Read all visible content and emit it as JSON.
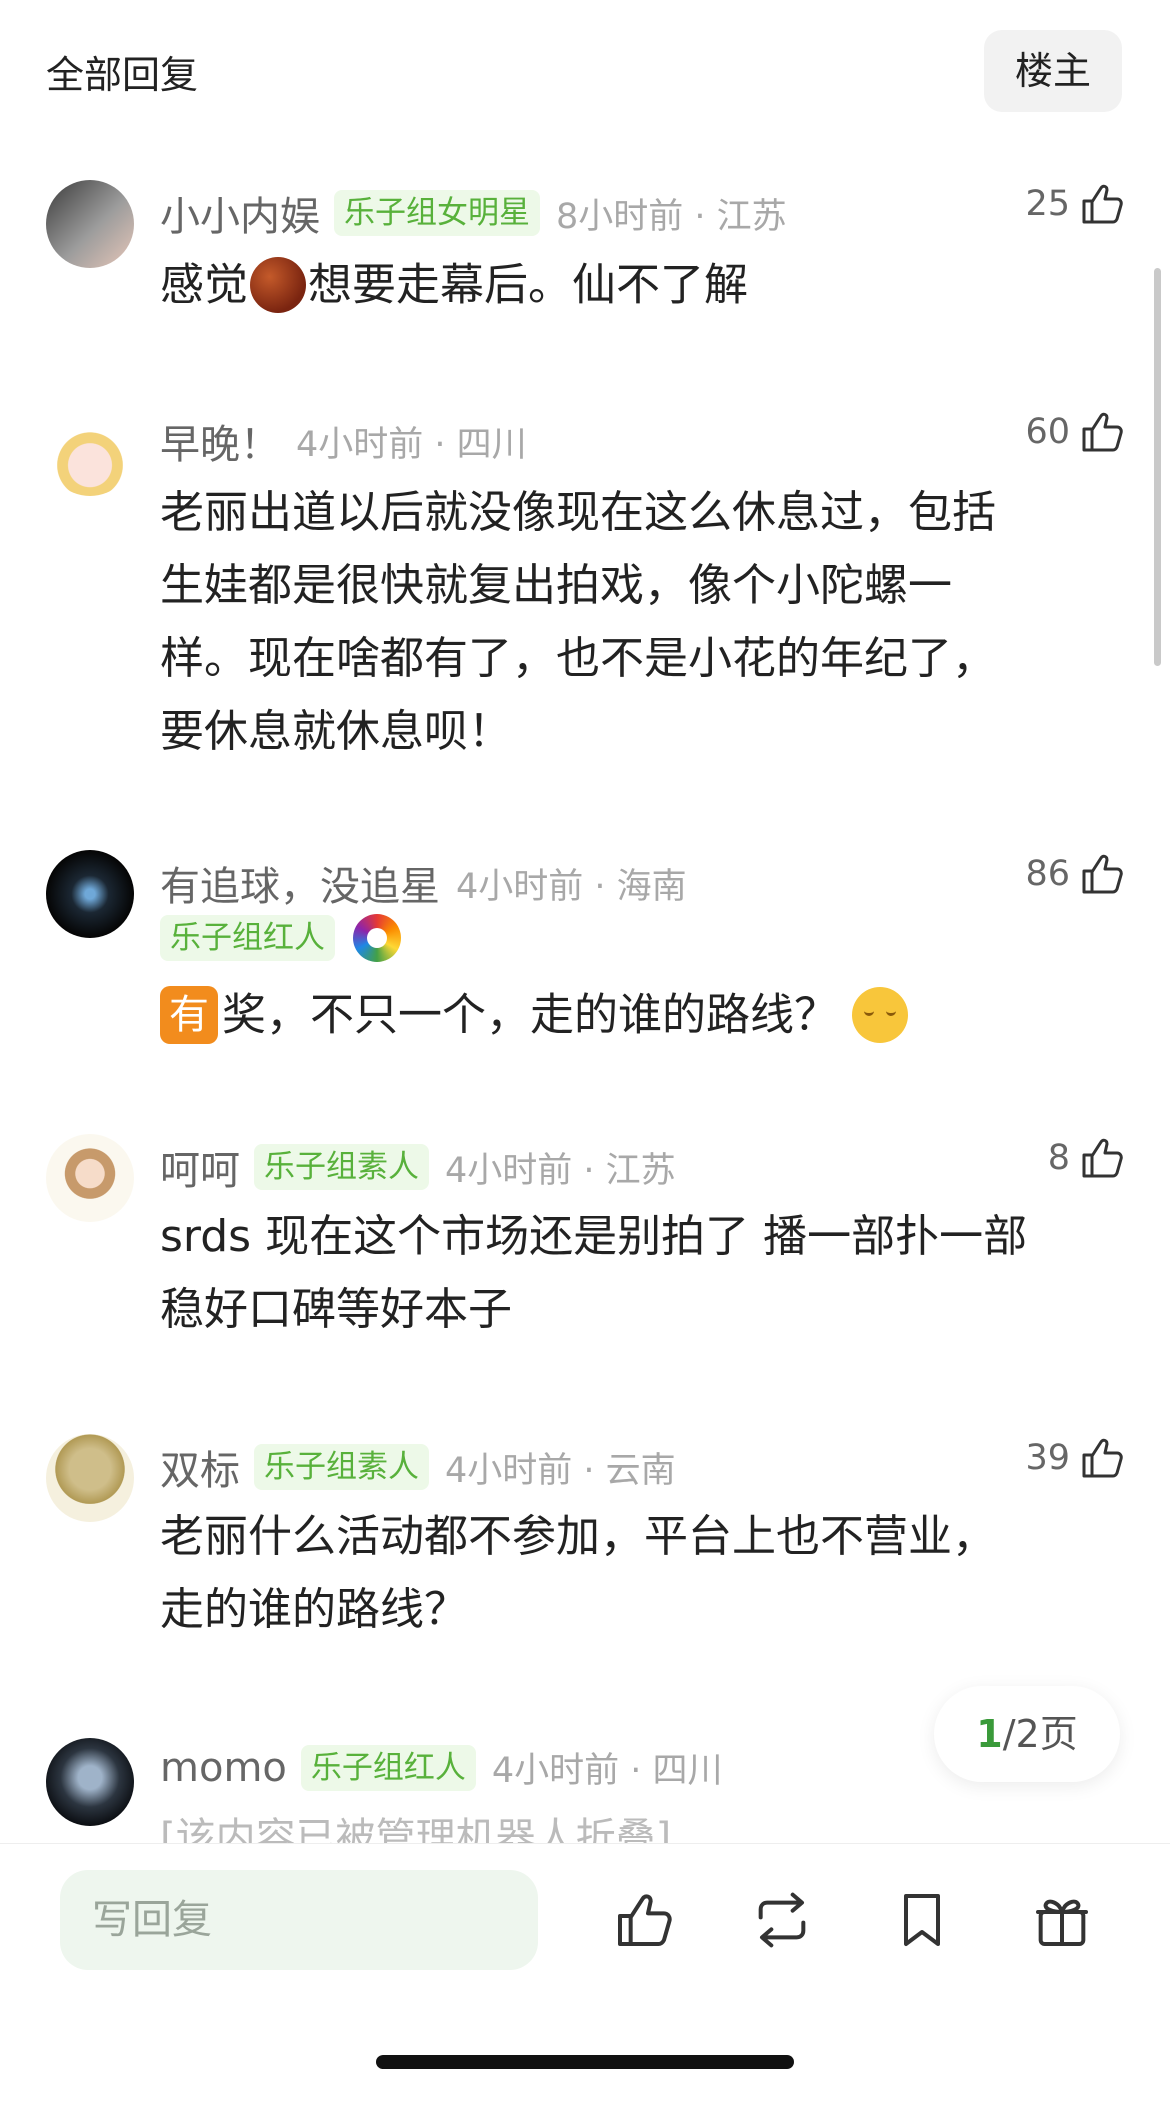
{
  "header": {
    "title": "全部回复",
    "op_button": "楼主"
  },
  "comments": [
    {
      "username": "小小内娱",
      "badge": "乐子组女明星",
      "time": "8小时前 · 江苏",
      "likes": "25",
      "text_a": "感觉",
      "text_b": "想要走幕后。仙不了解"
    },
    {
      "username": "早晚！",
      "badge": "",
      "time": "4小时前 · 四川",
      "likes": "60",
      "text_lines": [
        "老丽出道以后就没像现在这么休息过，包括",
        "生娃都是很快就复出拍戏，像个小陀螺一",
        "样。现在啥都有了，也不是小花的年纪了，",
        "要休息就休息呗！"
      ]
    },
    {
      "username": "有追球，没追星",
      "badge": "乐子组红人",
      "time": "4小时前 · 海南",
      "likes": "86",
      "emoji_label": "有",
      "text": "奖，不只一个，走的谁的路线？"
    },
    {
      "username": "呵呵",
      "badge": "乐子组素人",
      "time": "4小时前 · 江苏",
      "likes": "8",
      "text_lines": [
        "srds 现在这个市场还是别拍了 播一部扑一部",
        "稳好口碑等好本子"
      ]
    },
    {
      "username": "双标",
      "badge": "乐子组素人",
      "time": "4小时前 · 云南",
      "likes": "39",
      "text_lines": [
        "老丽什么活动都不参加，平台上也不营业，",
        "走的谁的路线？"
      ]
    },
    {
      "username": "momo",
      "badge": "乐子组红人",
      "time": "4小时前 · 四川",
      "likes": "",
      "text": "[该内容已被管理机器人折叠]"
    }
  ],
  "pagination": {
    "current": "1",
    "total_label": "/2页"
  },
  "bottom_bar": {
    "reply_placeholder": "写回复",
    "icons": [
      "thumbs-up-icon",
      "repost-icon",
      "bookmark-icon",
      "gift-icon"
    ]
  },
  "colors": {
    "badge_text": "#58b13b",
    "badge_bg": "#edf9e8",
    "page_accent": "#3a9a3a",
    "input_bg": "#eef6ee"
  }
}
